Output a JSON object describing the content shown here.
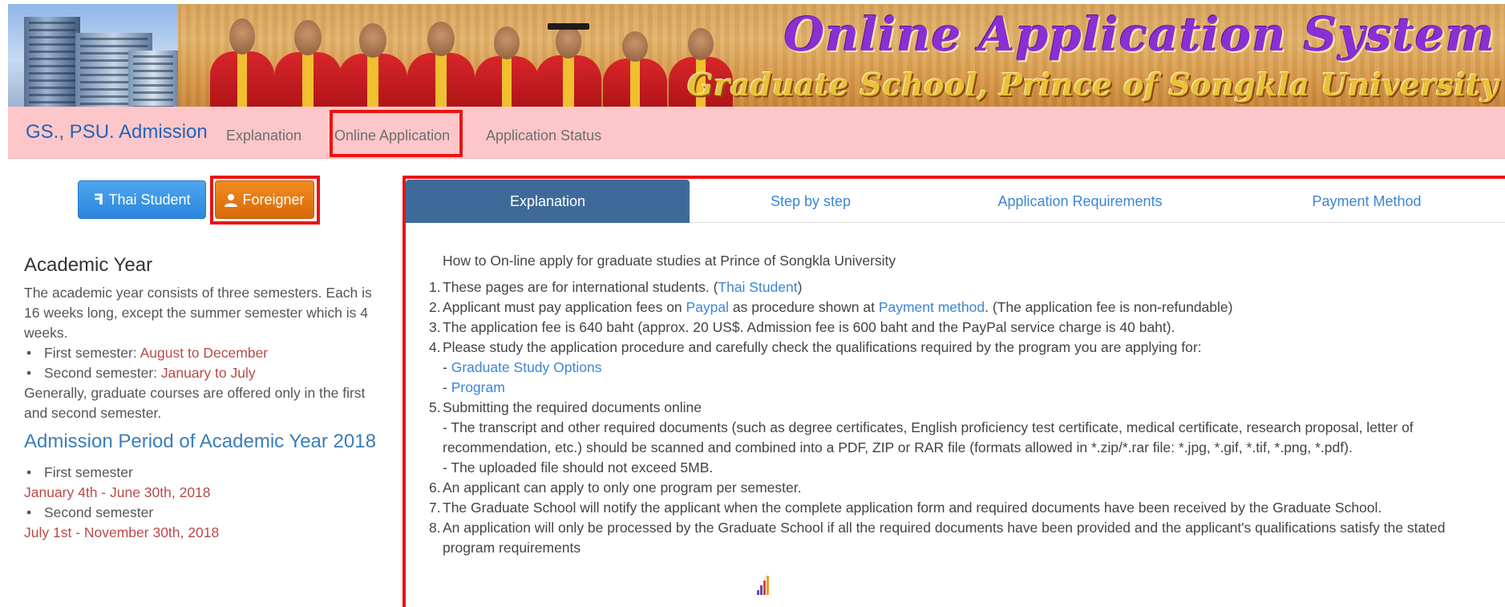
{
  "banner": {
    "title": "Online Application System",
    "subtitle": "Graduate School, Prince of Songkla University"
  },
  "navbar": {
    "brand": "GS., PSU. Admission",
    "items": [
      {
        "label": "Explanation"
      },
      {
        "label": "Online Application"
      },
      {
        "label": "Application Status"
      }
    ]
  },
  "buttons": {
    "thai": {
      "label": "Thai Student",
      "icon": "thai-letter-icon"
    },
    "foreigner": {
      "label": "Foreigner",
      "icon": "user-icon"
    }
  },
  "sidebar": {
    "academic_title": "Academic Year",
    "academic_intro": "The academic year consists of three semesters. Each is 16 weeks long, except the summer semester which is 4 weeks.",
    "semesters": [
      {
        "prefix": "First semester: ",
        "value": "August to December"
      },
      {
        "prefix": "Second semester: ",
        "value": "January to July"
      }
    ],
    "academic_note": "Generally, graduate courses are offered only in the first and second semester.",
    "admission_title": "Admission Period of Academic Year 2018",
    "periods": [
      {
        "label": "First semester",
        "dates": "January 4th - June 30th, 2018"
      },
      {
        "label": "Second semester",
        "dates": "July 1st - November 30th, 2018"
      }
    ]
  },
  "tabs": [
    {
      "label": "Explanation",
      "active": true
    },
    {
      "label": "Step by step",
      "active": false
    },
    {
      "label": "Application Requirements",
      "active": false
    },
    {
      "label": "Payment Method",
      "active": false
    }
  ],
  "content": {
    "intro": "How to On-line apply for graduate studies at Prince of Songkla University",
    "item1": {
      "num": "1.",
      "text": "These pages are for international students. (",
      "link": "Thai Student",
      "tail": ")"
    },
    "item2": {
      "num": "2.",
      "text1": "Applicant must pay application fees on ",
      "link1": "Paypal",
      "text2": " as procedure shown at ",
      "link2": "Payment method",
      "text3": ". (The application fee is non-refundable)"
    },
    "item3": {
      "num": "3.",
      "text": "The application fee is 640 baht (approx. 20 US$. Admission fee is 600 baht and the PayPal service charge is 40 baht)."
    },
    "item4": {
      "num": "4.",
      "text": "Please study the application procedure and carefully check the qualifications required by the program you are applying for:",
      "dash": "- ",
      "link1": "Graduate Study Options",
      "link2": "Program"
    },
    "item5": {
      "num": "5.",
      "text": "Submitting the required documents online",
      "sub1": "- The transcript and other required documents (such as degree certificates, English proficiency test certificate, medical certificate, research proposal, letter of recommendation, etc.) should be scanned and combined into a PDF, ZIP or RAR file (formats allowed in *.zip/*.rar file: *.jpg, *.gif, *.tif, *.png, *.pdf).",
      "sub2": "- The uploaded file should not exceed 5MB."
    },
    "item6": {
      "num": "6.",
      "text": "An applicant can apply to only one program per semester."
    },
    "item7": {
      "num": "7.",
      "text": "The Graduate School will notify the applicant when the complete application form and required documents have been received by the Graduate School."
    },
    "item8": {
      "num": "8.",
      "text": "An application will only be processed by the Graduate School if all the required documents have been provided and the applicant's qualifications satisfy the stated program requirements"
    }
  },
  "colors": {
    "navbar_bg": "#fdc7c9",
    "brand": "#2463b8",
    "link": "#3c85d4",
    "active_tab": "#3e6a9a",
    "date_red": "#b94a48",
    "highlight": "#ee1111",
    "thai_button": "#2b86dc",
    "foreigner_button": "#d9690a"
  }
}
